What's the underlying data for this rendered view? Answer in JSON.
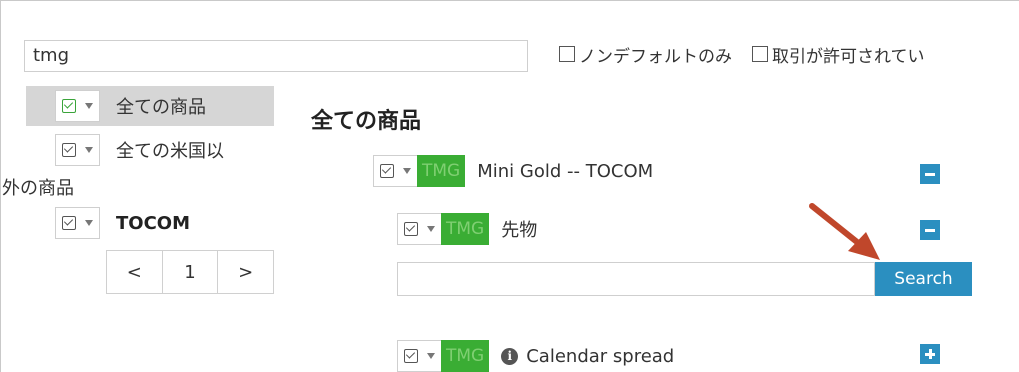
{
  "search": {
    "value": "tmg"
  },
  "filters": [
    {
      "label": "ノンデフォルトのみ"
    },
    {
      "label": "取引が許可されてい"
    }
  ],
  "tree": {
    "items": [
      {
        "label": "全ての商品",
        "selected": true
      },
      {
        "label_line1": "全ての米国以",
        "label_line2": "外の商品"
      },
      {
        "label": "TOCOM"
      }
    ],
    "pager": {
      "prev": "<",
      "page": "1",
      "next": ">"
    }
  },
  "main": {
    "heading": "全ての商品",
    "nodes": [
      {
        "tag": "TMG",
        "label": "Mini Gold -- TOCOM",
        "action": "collapse"
      },
      {
        "tag": "TMG",
        "label": "先物",
        "action": "collapse"
      },
      {
        "tag": "TMG",
        "label": "Calendar spread",
        "action": "expand"
      }
    ],
    "search_button": "Search"
  },
  "colors": {
    "accent": "#2b8fc0",
    "tag_bg": "#3aad34",
    "annotation_arrow": "#c0472b"
  },
  "icons": {
    "info": "i"
  }
}
